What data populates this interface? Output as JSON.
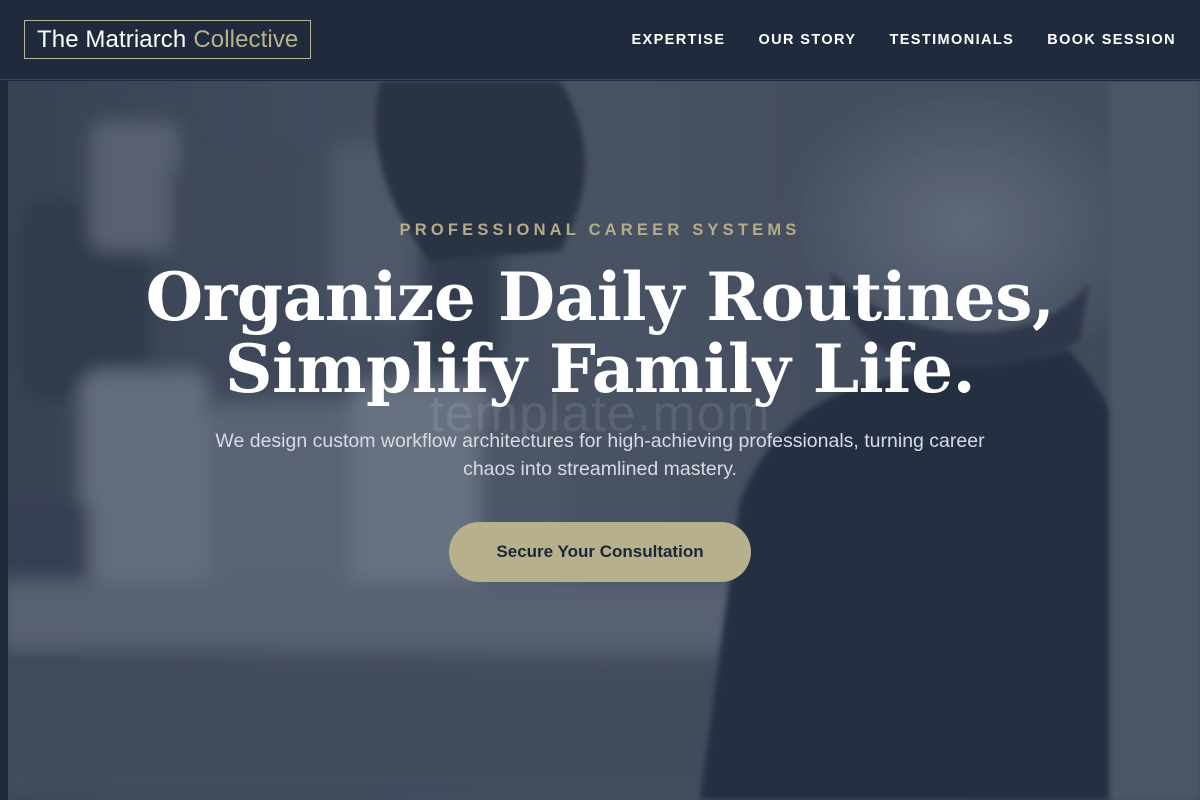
{
  "header": {
    "logo_main": "The Matriarch",
    "logo_accent": "Collective",
    "nav": [
      {
        "label": "EXPERTISE"
      },
      {
        "label": "OUR STORY"
      },
      {
        "label": "TESTIMONIALS"
      },
      {
        "label": "BOOK SESSION"
      }
    ]
  },
  "hero": {
    "eyebrow": "PROFESSIONAL CAREER SYSTEMS",
    "headline_line1": "Organize Daily Routines,",
    "headline_line2": "Simplify Family Life.",
    "subtext": "We design custom workflow architectures for high-achieving professionals, turning career chaos into streamlined mastery.",
    "cta_label": "Secure Your Consultation",
    "watermark": "template.mom",
    "background_image": "man-smiling-in-kitchen-photo"
  },
  "colors": {
    "navy": "#1f2a3c",
    "gold": "#b7b08d",
    "white": "#ffffff"
  }
}
